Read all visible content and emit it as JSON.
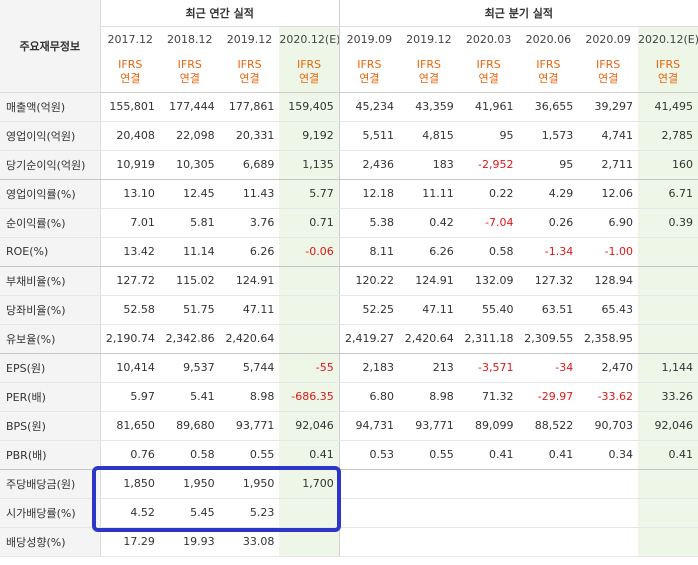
{
  "header": {
    "row_label": "주요재무정보",
    "annual_title": "최근 연간 실적",
    "quarterly_title": "최근 분기 실적",
    "ifrs_line1": "IFRS",
    "ifrs_line2": "연결",
    "annual_periods": [
      "2017.12",
      "2018.12",
      "2019.12",
      "2020.12(E)"
    ],
    "quarterly_periods": [
      "2019.09",
      "2019.12",
      "2020.03",
      "2020.06",
      "2020.09",
      "2020.12(E)"
    ]
  },
  "rows": [
    {
      "label": "매출액(억원)",
      "values": [
        "155,801",
        "177,444",
        "177,861",
        "159,405",
        "45,234",
        "43,359",
        "41,961",
        "36,655",
        "39,297",
        "41,495"
      ]
    },
    {
      "label": "영업이익(억원)",
      "values": [
        "20,408",
        "22,098",
        "20,331",
        "9,192",
        "5,511",
        "4,815",
        "95",
        "1,573",
        "4,741",
        "2,785"
      ]
    },
    {
      "label": "당기순이익(억원)",
      "values": [
        "10,919",
        "10,305",
        "6,689",
        "1,135",
        "2,436",
        "183",
        "-2,952",
        "95",
        "2,711",
        "160"
      ]
    },
    {
      "label": "영업이익률(%)",
      "values": [
        "13.10",
        "12.45",
        "11.43",
        "5.77",
        "12.18",
        "11.11",
        "0.22",
        "4.29",
        "12.06",
        "6.71"
      ]
    },
    {
      "label": "순이익률(%)",
      "values": [
        "7.01",
        "5.81",
        "3.76",
        "0.71",
        "5.38",
        "0.42",
        "-7.04",
        "0.26",
        "6.90",
        "0.39"
      ]
    },
    {
      "label": "ROE(%)",
      "values": [
        "13.42",
        "11.14",
        "6.26",
        "-0.06",
        "8.11",
        "6.26",
        "0.58",
        "-1.34",
        "-1.00",
        ""
      ]
    },
    {
      "label": "부채비율(%)",
      "values": [
        "127.72",
        "115.02",
        "124.91",
        "",
        "120.22",
        "124.91",
        "132.09",
        "127.32",
        "128.94",
        ""
      ]
    },
    {
      "label": "당좌비율(%)",
      "values": [
        "52.58",
        "51.75",
        "47.11",
        "",
        "52.25",
        "47.11",
        "55.40",
        "63.51",
        "65.43",
        ""
      ]
    },
    {
      "label": "유보율(%)",
      "values": [
        "2,190.74",
        "2,342.86",
        "2,420.64",
        "",
        "2,419.27",
        "2,420.64",
        "2,311.18",
        "2,309.55",
        "2,358.95",
        ""
      ]
    },
    {
      "label": "EPS(원)",
      "values": [
        "10,414",
        "9,537",
        "5,744",
        "-55",
        "2,183",
        "213",
        "-3,571",
        "-34",
        "2,470",
        "1,144"
      ]
    },
    {
      "label": "PER(배)",
      "values": [
        "5.97",
        "5.41",
        "8.98",
        "-686.35",
        "6.80",
        "8.98",
        "71.32",
        "-29.97",
        "-33.62",
        "33.26"
      ]
    },
    {
      "label": "BPS(원)",
      "values": [
        "81,650",
        "89,680",
        "93,771",
        "92,046",
        "94,731",
        "93,771",
        "89,099",
        "88,522",
        "90,703",
        "92,046"
      ]
    },
    {
      "label": "PBR(배)",
      "values": [
        "0.76",
        "0.58",
        "0.55",
        "0.41",
        "0.53",
        "0.55",
        "0.41",
        "0.41",
        "0.34",
        "0.41"
      ]
    },
    {
      "label": "주당배당금(원)",
      "values": [
        "1,850",
        "1,950",
        "1,950",
        "1,700",
        "",
        "",
        "",
        "",
        "",
        ""
      ]
    },
    {
      "label": "시가배당률(%)",
      "values": [
        "4.52",
        "5.45",
        "5.23",
        "",
        "",
        "",
        "",
        "",
        "",
        ""
      ]
    },
    {
      "label": "배당성향(%)",
      "values": [
        "17.29",
        "19.93",
        "33.08",
        "",
        "",
        "",
        "",
        "",
        "",
        ""
      ]
    }
  ],
  "colors": {
    "highlight_box": "#2c36c9",
    "negative_value": "#e01717",
    "ifrs_label": "#e8650c",
    "estimate_bg": "#eef6e7"
  }
}
